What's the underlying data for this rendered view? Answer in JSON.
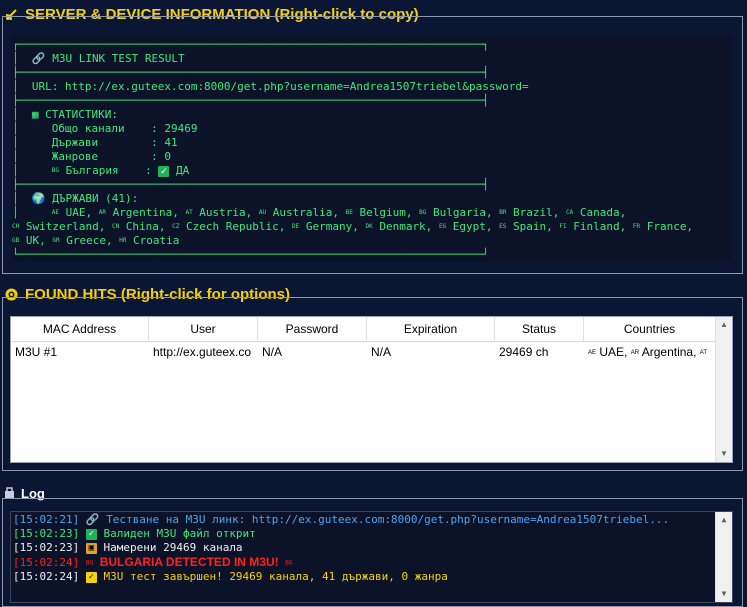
{
  "server_section": {
    "title": "SERVER & DEVICE INFORMATION  (Right-click to copy)",
    "lines": {
      "header": "M3U LINK TEST RESULT",
      "url": "URL: http://ex.guteex.com:8000/get.php?username=Andrea1507triebel&password=",
      "stats_title": "СТАТИСТИКИ:",
      "total": "Общо канали    : 29469",
      "countries": "Държави        : 41",
      "genres": "Жанрове        : 0",
      "bulgaria_label": "България    :",
      "bulgaria_value": "ДА",
      "countries_title": "ДЪРЖАВИ (41):"
    },
    "country_list": [
      {
        "code": "AE",
        "name": "UAE"
      },
      {
        "code": "AR",
        "name": "Argentina"
      },
      {
        "code": "AT",
        "name": "Austria"
      },
      {
        "code": "AU",
        "name": "Australia"
      },
      {
        "code": "BE",
        "name": "Belgium"
      },
      {
        "code": "BG",
        "name": "Bulgaria"
      },
      {
        "code": "BR",
        "name": "Brazil"
      },
      {
        "code": "CA",
        "name": "Canada"
      },
      {
        "code": "CH",
        "name": "Switzerland"
      },
      {
        "code": "CN",
        "name": "China"
      },
      {
        "code": "CZ",
        "name": "Czech Republic"
      },
      {
        "code": "DE",
        "name": "Germany"
      },
      {
        "code": "DK",
        "name": "Denmark"
      },
      {
        "code": "EG",
        "name": "Egypt"
      },
      {
        "code": "ES",
        "name": "Spain"
      },
      {
        "code": "FI",
        "name": "Finland"
      },
      {
        "code": "FR",
        "name": "France"
      },
      {
        "code": "GB",
        "name": "UK"
      },
      {
        "code": "GR",
        "name": "Greece"
      },
      {
        "code": "HR",
        "name": "Croatia"
      }
    ]
  },
  "hits_section": {
    "title": "FOUND HITS  (Right-click for options)",
    "columns": [
      "MAC Address",
      "User",
      "Password",
      "Expiration",
      "Status",
      "Countries"
    ],
    "rows": [
      {
        "mac": "M3U #1",
        "user": "http://ex.guteex.co",
        "password": "N/A",
        "expiration": "N/A",
        "status": "29469 ch",
        "countries_a": "UAE,",
        "countries_b": "Argentina,",
        "flag_a": "AE",
        "flag_b": "AR",
        "flag_c": "AT"
      }
    ]
  },
  "log_section": {
    "title": "Log",
    "entries": [
      {
        "ts": "[15:02:21]",
        "text": "Тестване на M3U линк: http://ex.guteex.com:8000/get.php?username=Andrea1507triebel..."
      },
      {
        "ts": "[15:02:23]",
        "text": "Валиден M3U файл открит"
      },
      {
        "ts": "[15:02:23]",
        "text": "Намерени 29469 канала"
      },
      {
        "ts": "[15:02:24]",
        "text": "BULGARIA DETECTED IN M3U!",
        "flag": "BG"
      },
      {
        "ts": "[15:02:24]",
        "text": "M3U тест завършен! 29469 канала, 41 държави, 0 жанра"
      }
    ]
  },
  "colors": {
    "accent": "#f5d10a",
    "terminal_green": "#3ee878",
    "background": "#0b1634",
    "log_blue": "#4aa3f0",
    "alert_red": "#ff2020"
  }
}
